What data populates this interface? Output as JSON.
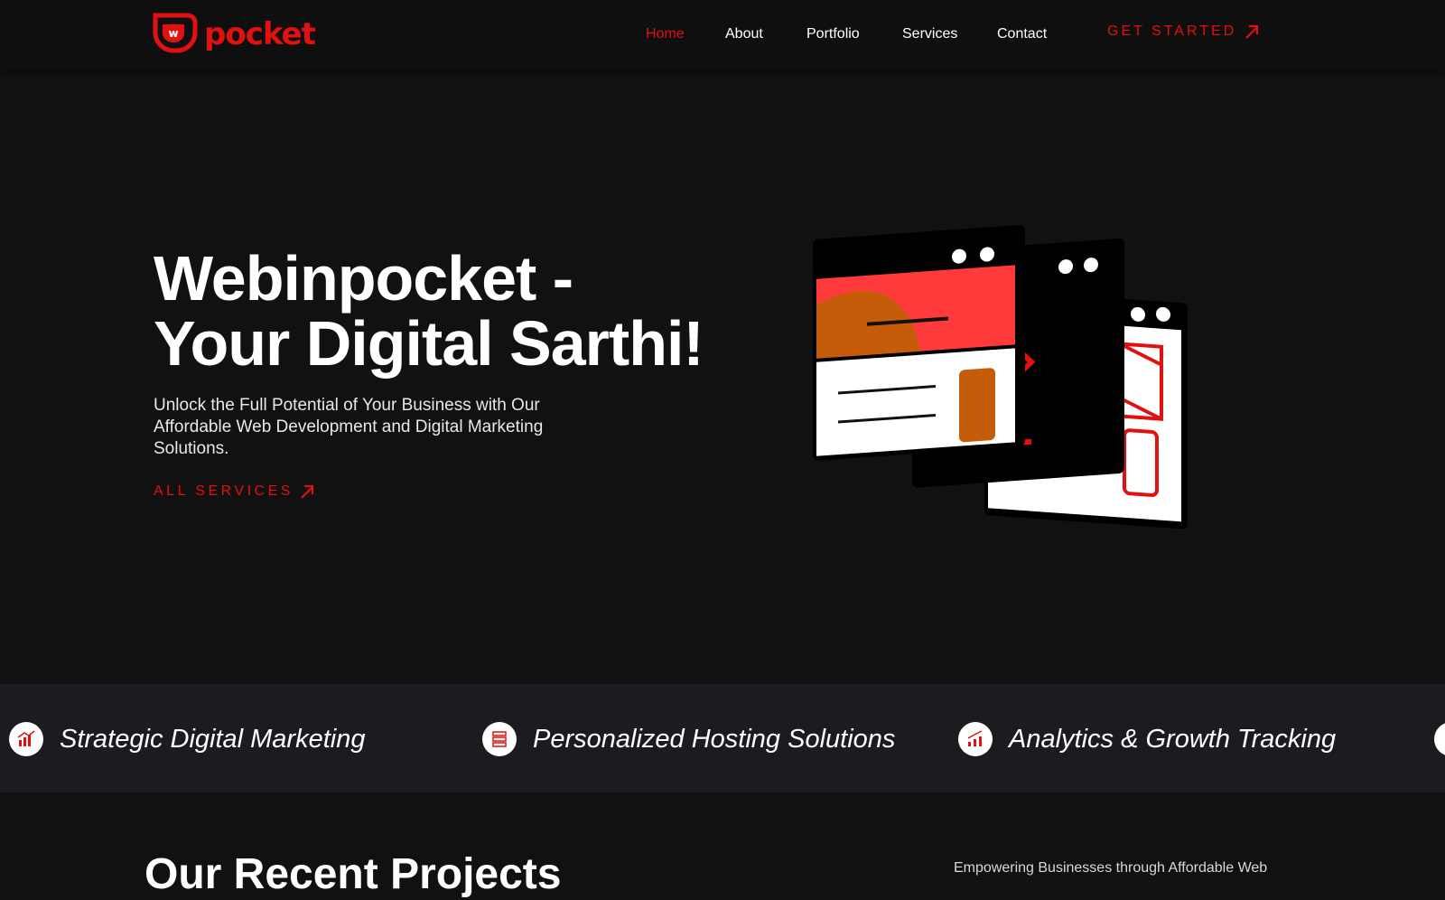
{
  "brand": {
    "name": "pocket",
    "accent": "#e31010",
    "background": "#111112",
    "band_background": "#1b1c20"
  },
  "nav": {
    "items": [
      "Home",
      "About",
      "Portfolio",
      "Services",
      "Contact"
    ],
    "active": "Home",
    "cta_label": "GET STARTED"
  },
  "hero": {
    "title_line1": "Webinpocket -",
    "title_line2": "Your Digital Sarthi!",
    "subtitle": "Unlock the Full Potential of Your Business with Our Affordable Web Development and Digital Marketing Solutions.",
    "link_label": "ALL SERVICES"
  },
  "band": {
    "items": [
      {
        "label": "Strategic Digital Marketing",
        "icon": "marketing-chart-icon"
      },
      {
        "label": "Personalized Hosting Solutions",
        "icon": "server-icon"
      },
      {
        "label": "Analytics & Growth Tracking",
        "icon": "growth-chart-icon"
      }
    ]
  },
  "projects": {
    "title": "Our Recent Projects",
    "description": "Empowering Businesses through Affordable Web"
  }
}
